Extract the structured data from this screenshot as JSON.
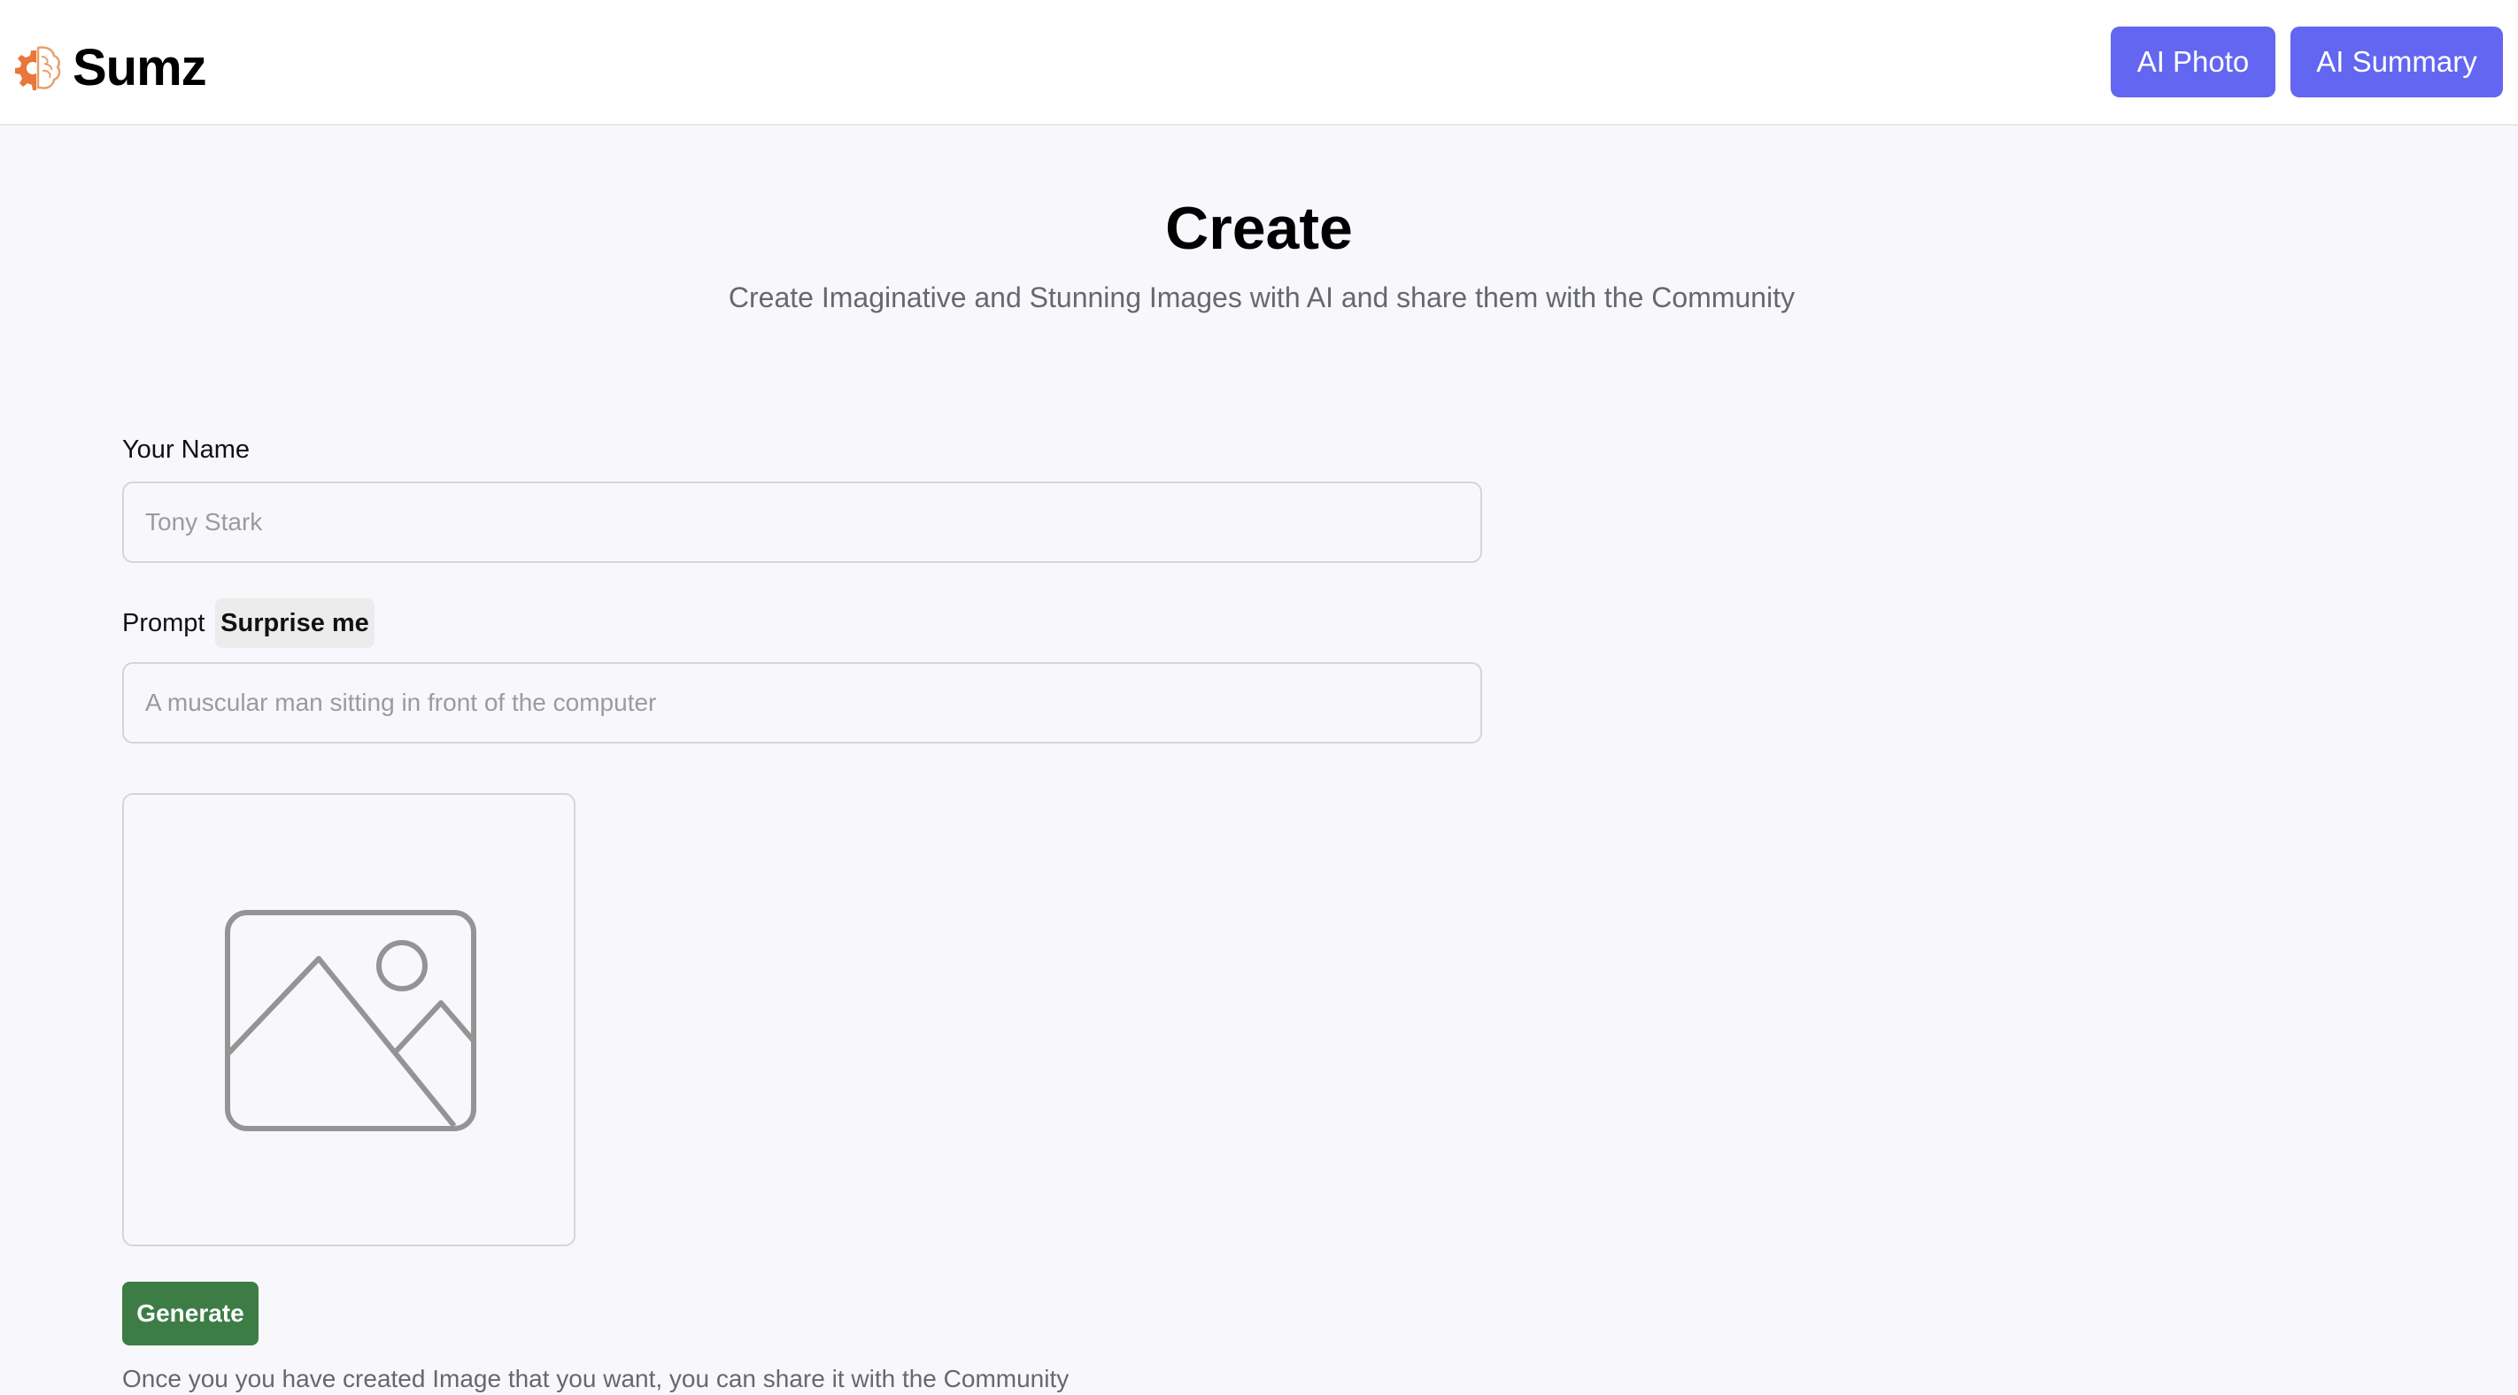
{
  "header": {
    "brand": "Sumz",
    "nav": {
      "ai_photo": "AI Photo",
      "ai_summary": "AI Summary"
    }
  },
  "main": {
    "title": "Create",
    "subtitle": "Create Imaginative and Stunning Images with AI and share them with the Community",
    "form": {
      "name_label": "Your Name",
      "name_placeholder": "Tony Stark",
      "prompt_label": "Prompt",
      "surprise_label": "Surprise me",
      "prompt_placeholder": "A muscular man sitting in front of the computer",
      "generate_label": "Generate"
    },
    "note": "Once you you have created Image that you want, you can share it with the Community"
  },
  "icons": {
    "logo": "brain-gear-icon",
    "preview": "image-placeholder-icon"
  },
  "colors": {
    "accent": "#6366f1",
    "generate": "#3d7d45",
    "logo_orange": "#e8773a",
    "page_bg": "#f8f8fc"
  }
}
